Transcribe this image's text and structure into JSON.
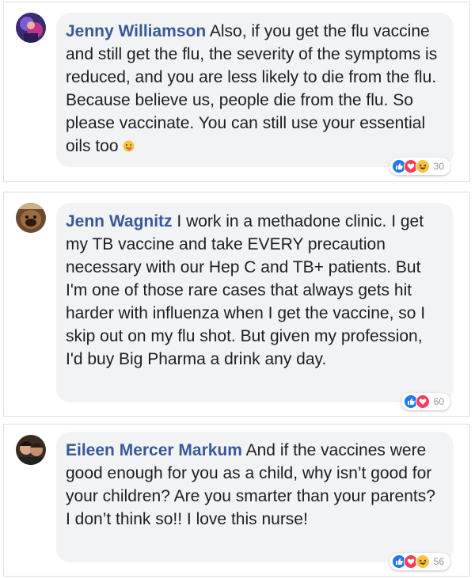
{
  "comments": [
    {
      "author": "Jenny Williamson",
      "text": "Also, if you get the flu vaccine and still get the flu, the severity of the symptoms is reduced, and you are less likely to die from the flu. Because believe us, people die from the flu. So please vaccinate. You can still use your essential oils too",
      "emoji": "winking-tongue-emoji",
      "reactions": [
        "like",
        "love",
        "haha"
      ],
      "reaction_count": "30",
      "avatar": "avatar-photo"
    },
    {
      "author": "Jenn Wagnitz",
      "text": "I work in a methadone clinic. I get my TB vaccine and take EVERY precaution necessary with our Hep C and TB+ patients. But I'm one of those rare cases that always gets hit harder with influenza when I get the vaccine, so I skip out on my flu shot. But given my profession, I'd buy Big Pharma a drink any day.",
      "reactions": [
        "like",
        "love"
      ],
      "reaction_count": "60",
      "avatar": "avatar-photo"
    },
    {
      "author": "Eileen Mercer Markum",
      "text": "And if the vaccines were good enough for you as a child, why isn’t good for your children? Are you smarter than your parents? I don’t think so!! I love this nurse!",
      "reactions": [
        "like",
        "love",
        "haha"
      ],
      "reaction_count": "56",
      "avatar": "avatar-photo"
    }
  ],
  "colors": {
    "name": "#385898",
    "bubble": "#f2f3f5",
    "like": "#2078f4",
    "love": "#f33e58",
    "haha": "#f7c242"
  }
}
